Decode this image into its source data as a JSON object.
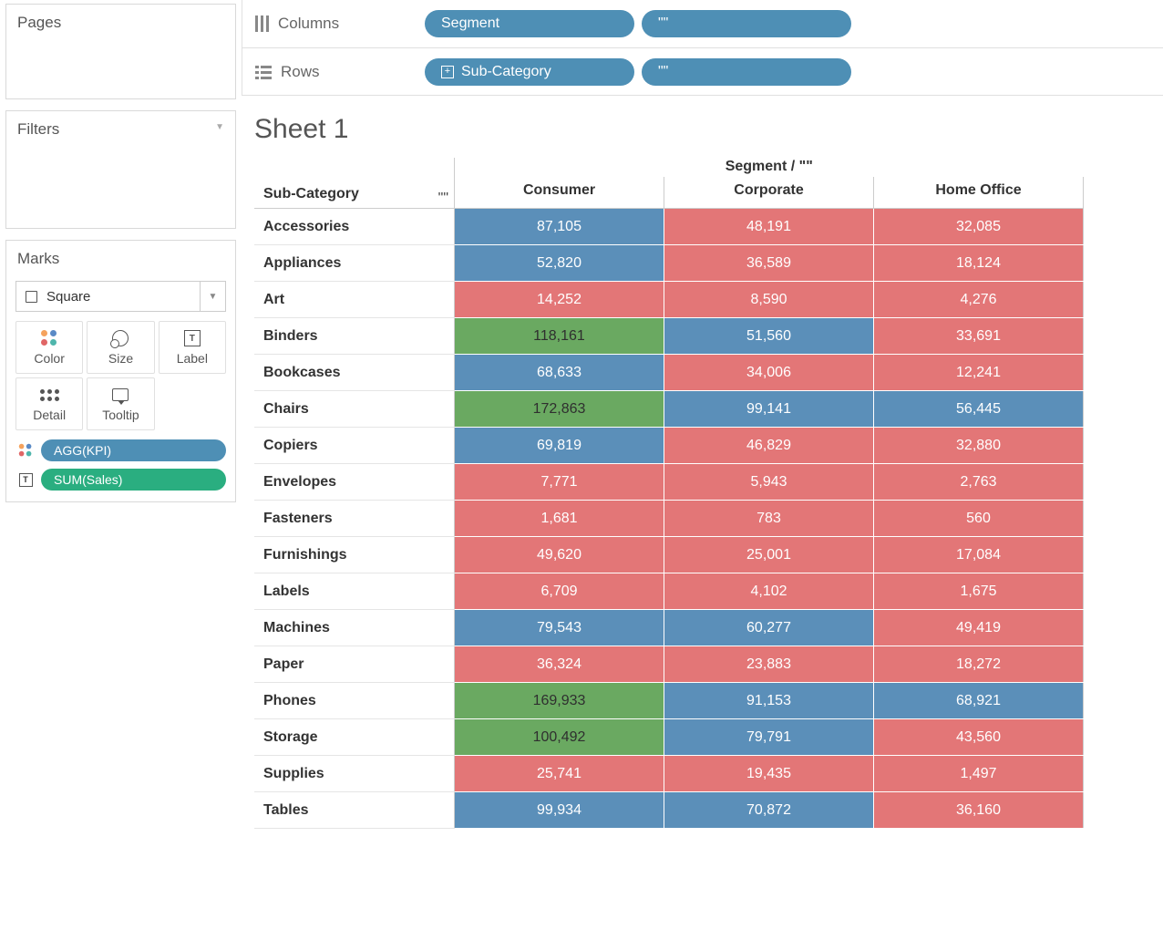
{
  "sidebar": {
    "pages_title": "Pages",
    "filters_title": "Filters",
    "marks_title": "Marks",
    "shape_select": "Square",
    "cards": {
      "color": "Color",
      "size": "Size",
      "label": "Label",
      "detail": "Detail",
      "tooltip": "Tooltip"
    },
    "pills": {
      "kpi": "AGG(KPI)",
      "sales": "SUM(Sales)"
    }
  },
  "shelves": {
    "columns_label": "Columns",
    "rows_label": "Rows",
    "columns_pills": [
      "Segment",
      "\"\""
    ],
    "rows_pills": [
      "Sub-Category",
      "\"\""
    ]
  },
  "viz": {
    "title": "Sheet 1",
    "segment_header": "Segment / \"\"",
    "columns": [
      "Consumer",
      "Corporate",
      "Home Office"
    ],
    "row_dim_label": "Sub-Category",
    "row_quotes": "\"\""
  },
  "chart_data": {
    "type": "heatmap",
    "title": "Sheet 1",
    "row_field": "Sub-Category",
    "col_field": "Segment",
    "columns": [
      "Consumer",
      "Corporate",
      "Home Office"
    ],
    "rows": [
      {
        "name": "Accessories",
        "values": [
          "87,105",
          "48,191",
          "32,085"
        ],
        "colors": [
          "blue",
          "red",
          "red"
        ]
      },
      {
        "name": "Appliances",
        "values": [
          "52,820",
          "36,589",
          "18,124"
        ],
        "colors": [
          "blue",
          "red",
          "red"
        ]
      },
      {
        "name": "Art",
        "values": [
          "14,252",
          "8,590",
          "4,276"
        ],
        "colors": [
          "red",
          "red",
          "red"
        ]
      },
      {
        "name": "Binders",
        "values": [
          "118,161",
          "51,560",
          "33,691"
        ],
        "colors": [
          "green",
          "blue",
          "red"
        ]
      },
      {
        "name": "Bookcases",
        "values": [
          "68,633",
          "34,006",
          "12,241"
        ],
        "colors": [
          "blue",
          "red",
          "red"
        ]
      },
      {
        "name": "Chairs",
        "values": [
          "172,863",
          "99,141",
          "56,445"
        ],
        "colors": [
          "green",
          "blue",
          "blue"
        ]
      },
      {
        "name": "Copiers",
        "values": [
          "69,819",
          "46,829",
          "32,880"
        ],
        "colors": [
          "blue",
          "red",
          "red"
        ]
      },
      {
        "name": "Envelopes",
        "values": [
          "7,771",
          "5,943",
          "2,763"
        ],
        "colors": [
          "red",
          "red",
          "red"
        ]
      },
      {
        "name": "Fasteners",
        "values": [
          "1,681",
          "783",
          "560"
        ],
        "colors": [
          "red",
          "red",
          "red"
        ]
      },
      {
        "name": "Furnishings",
        "values": [
          "49,620",
          "25,001",
          "17,084"
        ],
        "colors": [
          "red",
          "red",
          "red"
        ]
      },
      {
        "name": "Labels",
        "values": [
          "6,709",
          "4,102",
          "1,675"
        ],
        "colors": [
          "red",
          "red",
          "red"
        ]
      },
      {
        "name": "Machines",
        "values": [
          "79,543",
          "60,277",
          "49,419"
        ],
        "colors": [
          "blue",
          "blue",
          "red"
        ]
      },
      {
        "name": "Paper",
        "values": [
          "36,324",
          "23,883",
          "18,272"
        ],
        "colors": [
          "red",
          "red",
          "red"
        ]
      },
      {
        "name": "Phones",
        "values": [
          "169,933",
          "91,153",
          "68,921"
        ],
        "colors": [
          "green",
          "blue",
          "blue"
        ]
      },
      {
        "name": "Storage",
        "values": [
          "100,492",
          "79,791",
          "43,560"
        ],
        "colors": [
          "green",
          "blue",
          "red"
        ]
      },
      {
        "name": "Supplies",
        "values": [
          "25,741",
          "19,435",
          "1,497"
        ],
        "colors": [
          "red",
          "red",
          "red"
        ]
      },
      {
        "name": "Tables",
        "values": [
          "99,934",
          "70,872",
          "36,160"
        ],
        "colors": [
          "blue",
          "blue",
          "red"
        ]
      }
    ]
  }
}
